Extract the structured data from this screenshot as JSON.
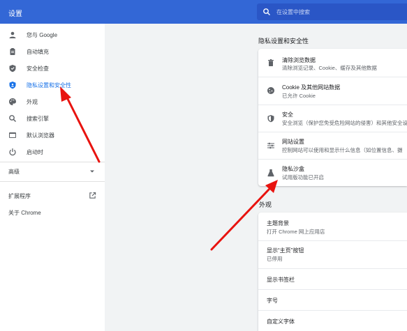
{
  "header": {
    "title": "设置",
    "search_placeholder": "在设置中搜索"
  },
  "sidebar": {
    "items": [
      {
        "label": "您与 Google",
        "icon": "person-icon"
      },
      {
        "label": "自动填充",
        "icon": "clipboard-icon"
      },
      {
        "label": "安全检查",
        "icon": "shield-check-icon"
      },
      {
        "label": "隐私设置和安全性",
        "icon": "shield-icon"
      },
      {
        "label": "外观",
        "icon": "palette-icon"
      },
      {
        "label": "搜索引擎",
        "icon": "search-icon"
      },
      {
        "label": "默认浏览器",
        "icon": "browser-icon"
      },
      {
        "label": "启动时",
        "icon": "power-icon"
      }
    ],
    "advanced": "高级",
    "extensions": "扩展程序",
    "about": "关于 Chrome"
  },
  "privacy": {
    "title": "隐私设置和安全性",
    "rows": [
      {
        "title": "清除浏览数据",
        "subtitle": "清除浏览记录、Cookie、缓存及其他数据",
        "icon": "trash-icon"
      },
      {
        "title": "Cookie 及其他网站数据",
        "subtitle": "已允许 Cookie",
        "icon": "cookie-icon"
      },
      {
        "title": "安全",
        "subtitle": "安全浏览（保护您免受危险网站的侵害）和其他安全设",
        "icon": "security-shield-icon"
      },
      {
        "title": "网站设置",
        "subtitle": "控制网站可以使用和显示什么信息（如位置信息、摄",
        "icon": "sliders-icon"
      },
      {
        "title": "隐私沙盒",
        "subtitle": "试用版功能已开启",
        "icon": "flask-icon"
      }
    ]
  },
  "appearance": {
    "title": "外观",
    "rows": [
      {
        "title": "主题背景",
        "subtitle": "打开 Chrome 网上应用店"
      },
      {
        "title": "显示“主页”按钮",
        "subtitle": "已停用"
      },
      {
        "title": "显示书签栏",
        "subtitle": ""
      },
      {
        "title": "字号",
        "subtitle": ""
      },
      {
        "title": "自定义字体",
        "subtitle": ""
      }
    ]
  },
  "colors": {
    "header": "#3367d6",
    "accent": "#1a73e8",
    "arrow": "#e8130f"
  }
}
